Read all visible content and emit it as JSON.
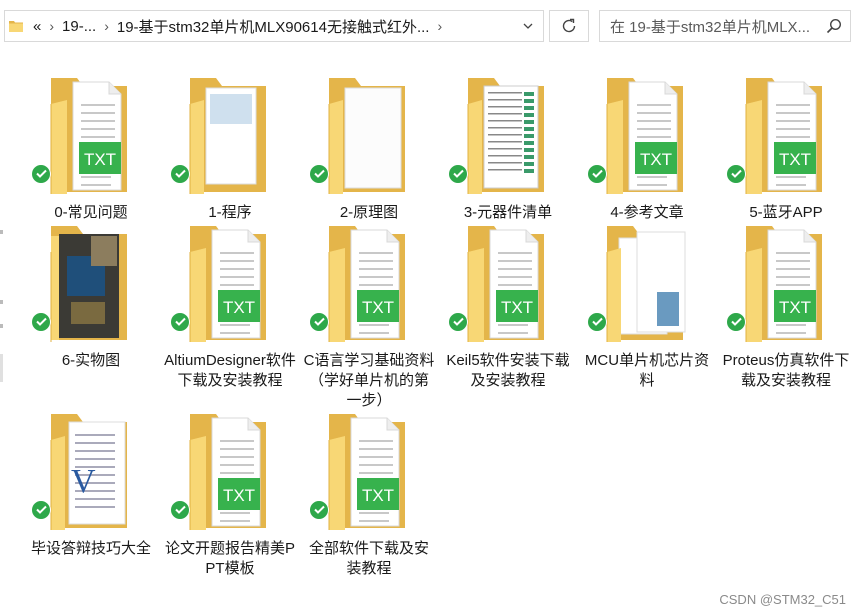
{
  "address_bar": {
    "overflow": "«",
    "crumbs": [
      "19-...",
      "19-基于stm32单片机MLX90614无接触式红外..."
    ],
    "dropdown_icon": "chevron-down-icon"
  },
  "refresh_icon": "refresh-icon",
  "search": {
    "placeholder": "在 19-基于stm32单片机MLX..."
  },
  "items": [
    {
      "label": "0-常见问题",
      "kind": "txt"
    },
    {
      "label": "1-程序",
      "kind": "folder"
    },
    {
      "label": "2-原理图",
      "kind": "blank"
    },
    {
      "label": "3-元器件清单",
      "kind": "sheet"
    },
    {
      "label": "4-参考文章",
      "kind": "txt"
    },
    {
      "label": "5-蓝牙APP",
      "kind": "txt"
    },
    {
      "label": "6-实物图",
      "kind": "photo"
    },
    {
      "label": "AltiumDesigner软件下载及安装教程",
      "kind": "txt"
    },
    {
      "label": "C语言学习基础资料（学好单片机的第一步）",
      "kind": "txt"
    },
    {
      "label": "Keil5软件安装下载及安装教程",
      "kind": "txt"
    },
    {
      "label": "MCU单片机芯片资料",
      "kind": "docs"
    },
    {
      "label": "Proteus仿真软件下载及安装教程",
      "kind": "txt"
    },
    {
      "label": "毕设答辩技巧大全",
      "kind": "doc"
    },
    {
      "label": "论文开题报告精美PPT模板",
      "kind": "txt"
    },
    {
      "label": "全部软件下载及安装教程",
      "kind": "txt"
    }
  ],
  "sync_status_icon": "sync-check-icon",
  "colors": {
    "folder_back": "#e4b54a",
    "folder_front": "#f8d775",
    "txt_green": "#37b24d",
    "check_green": "#2ea84a"
  },
  "watermark": "CSDN @STM32_C51"
}
